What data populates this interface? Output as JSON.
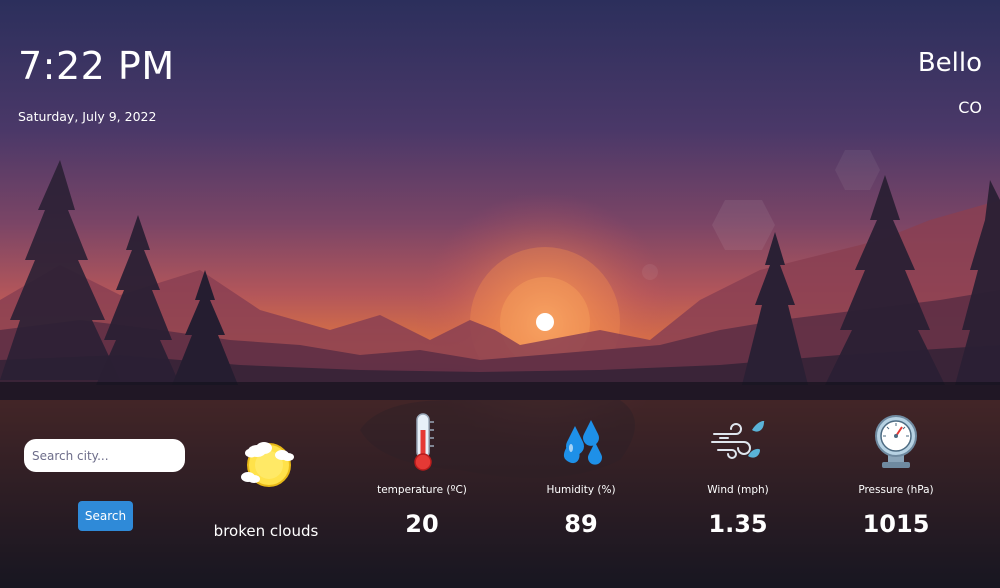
{
  "header": {
    "time": "7:22 PM",
    "date": "Saturday, July 9, 2022",
    "city": "Bello",
    "country": "CO"
  },
  "search": {
    "placeholder": "Search city...",
    "value": "",
    "button_label": "Search"
  },
  "weather": {
    "description": "broken clouds",
    "icon": "broken-clouds-icon"
  },
  "metrics": [
    {
      "label": "temperature (ºC)",
      "value": "20",
      "icon": "thermometer-icon"
    },
    {
      "label": "Humidity (%)",
      "value": "89",
      "icon": "humidity-drops-icon"
    },
    {
      "label": "Wind (mph)",
      "value": "1.35",
      "icon": "wind-icon"
    },
    {
      "label": "Pressure (hPa)",
      "value": "1015",
      "icon": "barometer-icon"
    }
  ],
  "colors": {
    "sky_top": "#2e3160",
    "sky_horizon": "#e07640",
    "sun": "#ffffff",
    "button": "#2f8ad8",
    "humidity_drops": "#1e90e8"
  }
}
